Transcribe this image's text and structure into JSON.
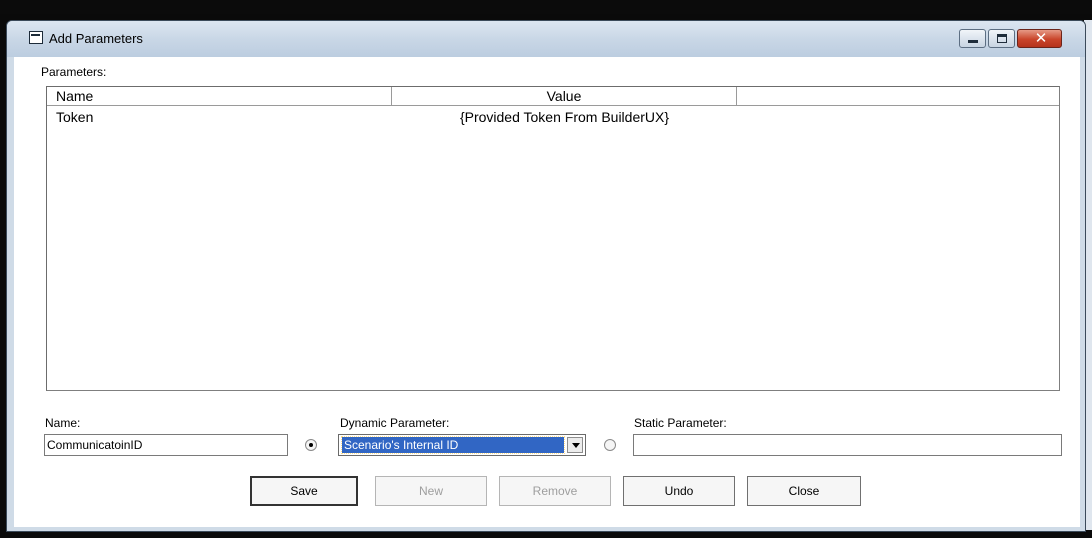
{
  "window": {
    "title": "Add Parameters"
  },
  "parameters_label": "Parameters:",
  "table": {
    "columns": [
      "Name",
      "Value",
      ""
    ],
    "rows": [
      {
        "name": "Token",
        "value": "{Provided Token From BuilderUX}"
      }
    ]
  },
  "form": {
    "name_label": "Name:",
    "name_value": "CommunicatoinID",
    "dynamic_label": "Dynamic Parameter:",
    "dynamic_value": "Scenario's Internal ID",
    "dynamic_selected": true,
    "static_label": "Static Parameter:",
    "static_value": "",
    "static_selected": false
  },
  "buttons": {
    "save": "Save",
    "new": "New",
    "remove": "Remove",
    "undo": "Undo",
    "close": "Close"
  },
  "colors": {
    "titlebar": "#c9d7e6",
    "selection": "#3166c4",
    "close_button": "#c9452b"
  }
}
